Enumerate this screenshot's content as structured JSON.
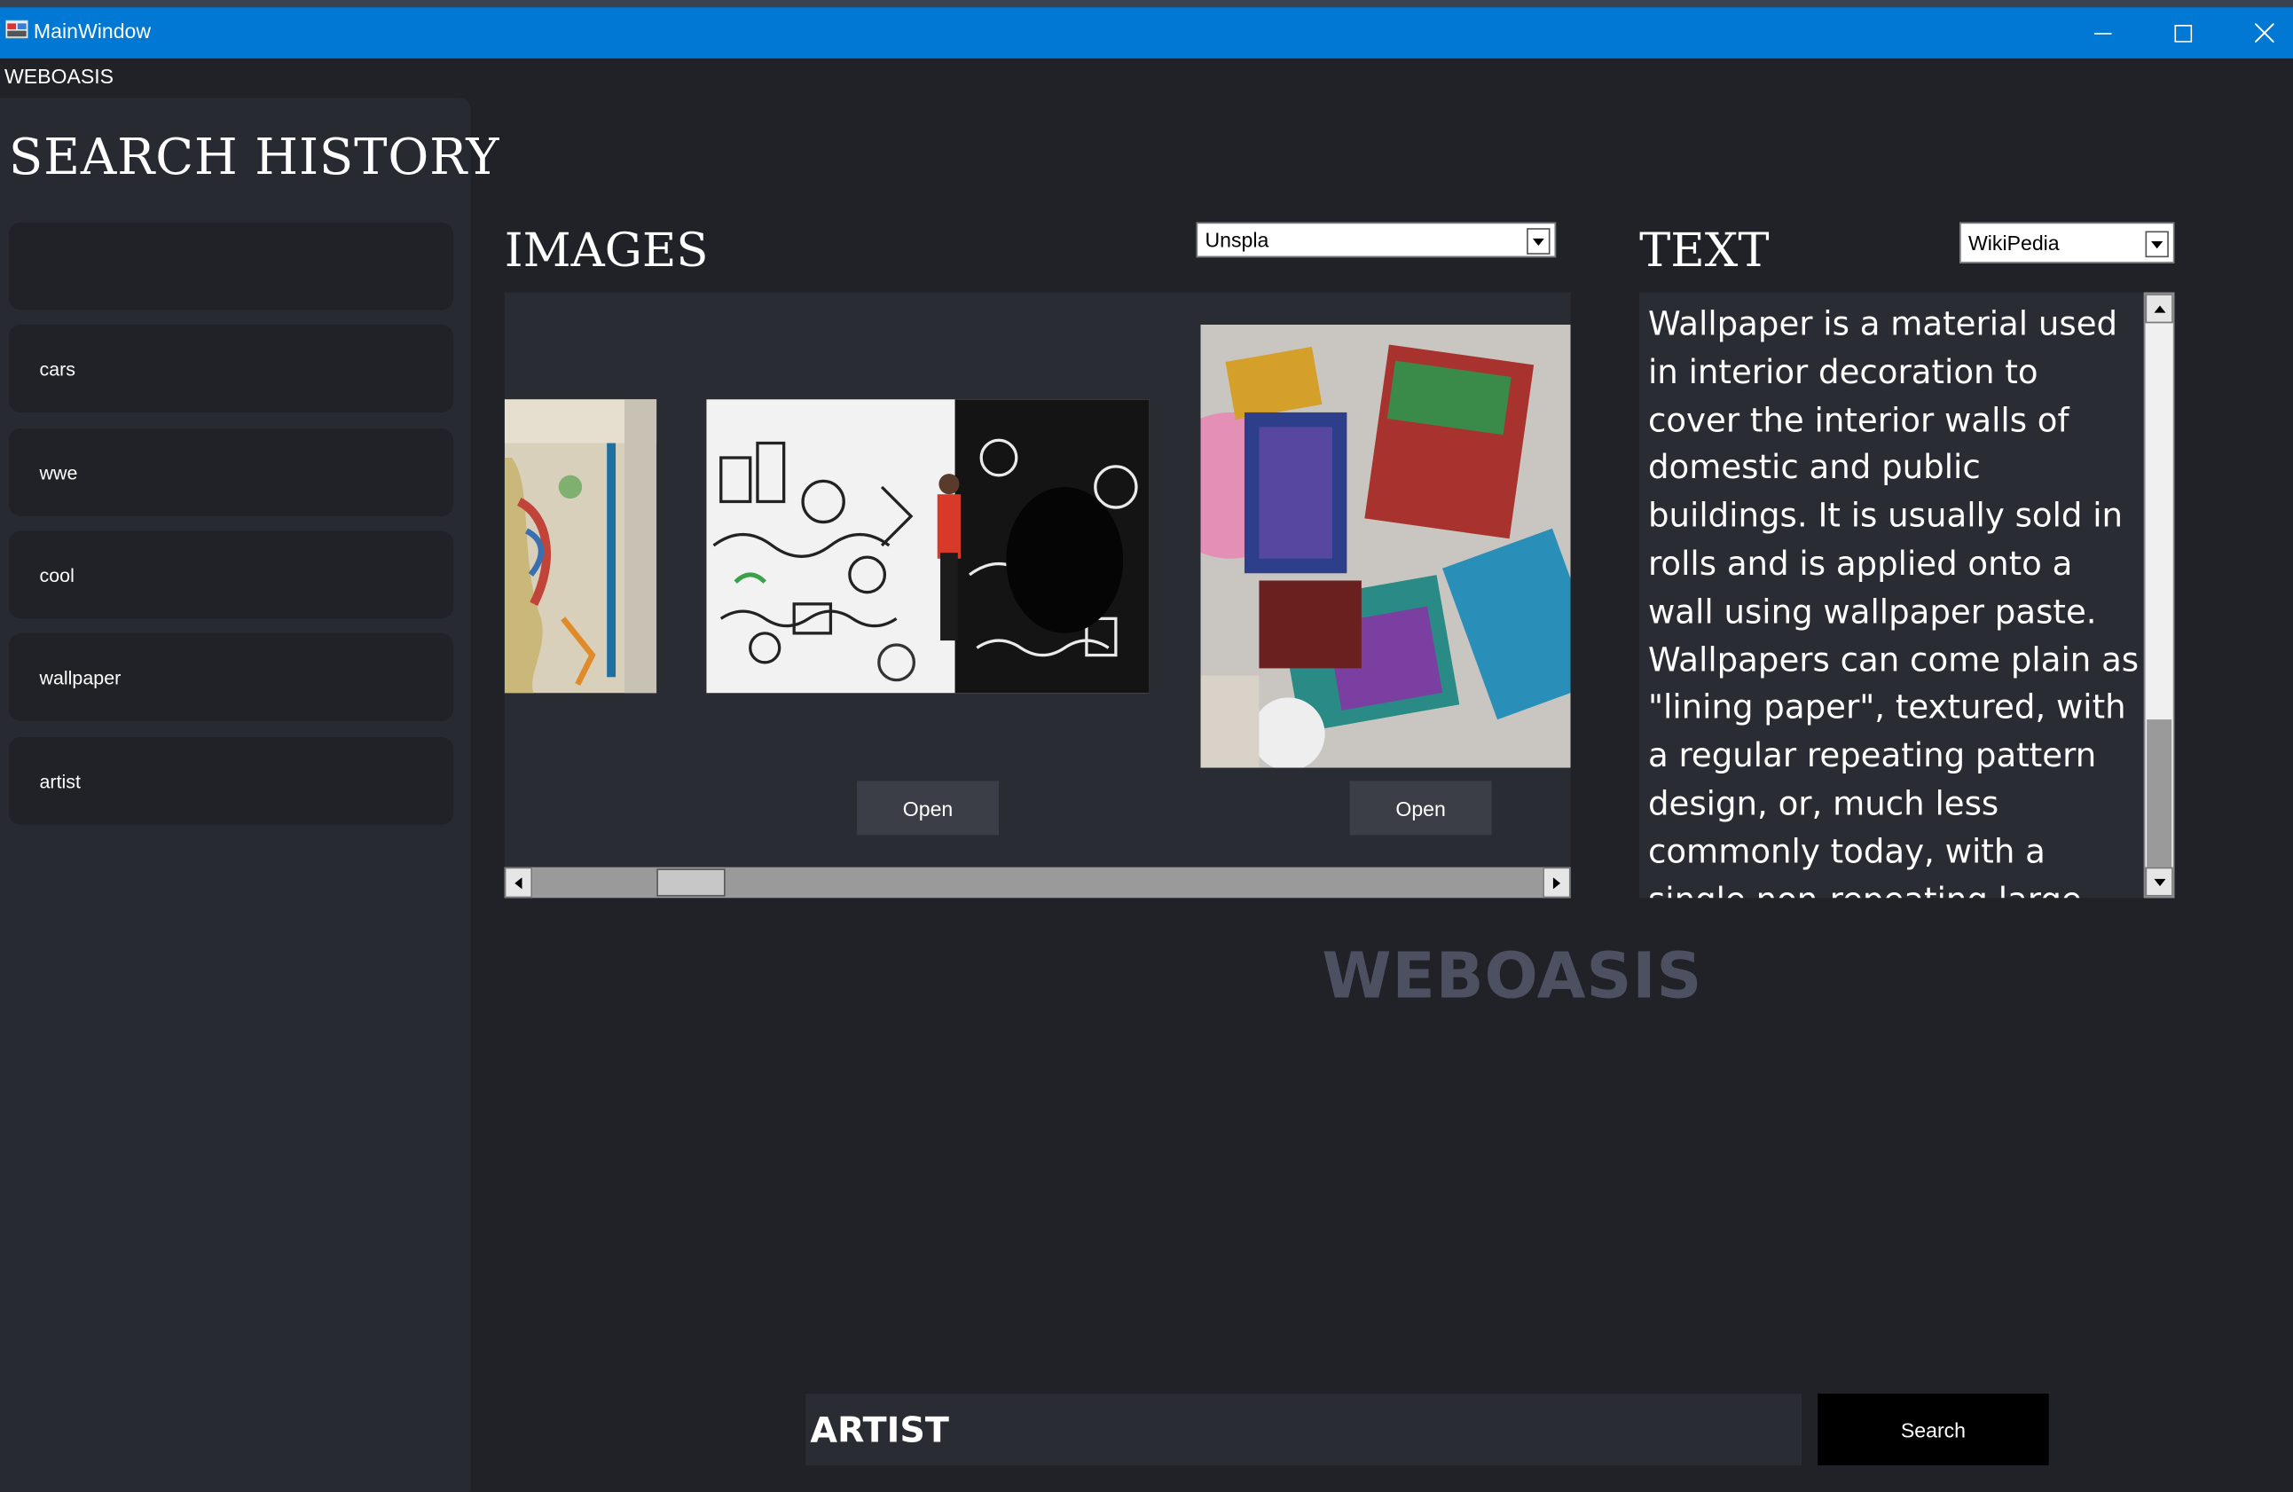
{
  "window": {
    "title": "MainWindow"
  },
  "app": {
    "name": "WEBOASIS",
    "watermark": "WEBOASIS"
  },
  "sidebar": {
    "title": "SEARCH HISTORY",
    "items": [
      {
        "label": ""
      },
      {
        "label": "cars"
      },
      {
        "label": "wwe"
      },
      {
        "label": "cool"
      },
      {
        "label": "wallpaper"
      },
      {
        "label": "artist"
      }
    ]
  },
  "images": {
    "heading": "IMAGES",
    "source_selected": "Unspla",
    "open_label": "Open"
  },
  "text": {
    "heading": "TEXT",
    "source_selected": "WikiPedia",
    "article": "Wallpaper is a material used in interior decoration to cover the interior walls of domestic and public buildings. It is usually sold in rolls and is applied onto a wall using wallpaper paste. Wallpapers can come plain as \"lining paper\", textured, with a regular repeating pattern design, or, much less commonly today, with a single non-repeating large design carried over a set"
  },
  "search": {
    "value": "ARTIST",
    "button_label": "Search"
  },
  "colors": {
    "titlebar": "#0078d4",
    "background": "#202228",
    "panel": "#2a2c33",
    "sidebar": "#282a31",
    "watermark": "#4d5060"
  },
  "icons": [
    "app-icon",
    "minimize-icon",
    "maximize-icon",
    "close-icon",
    "chevron-down-icon",
    "arrow-left-icon",
    "arrow-right-icon",
    "arrow-up-icon",
    "arrow-down-icon"
  ]
}
